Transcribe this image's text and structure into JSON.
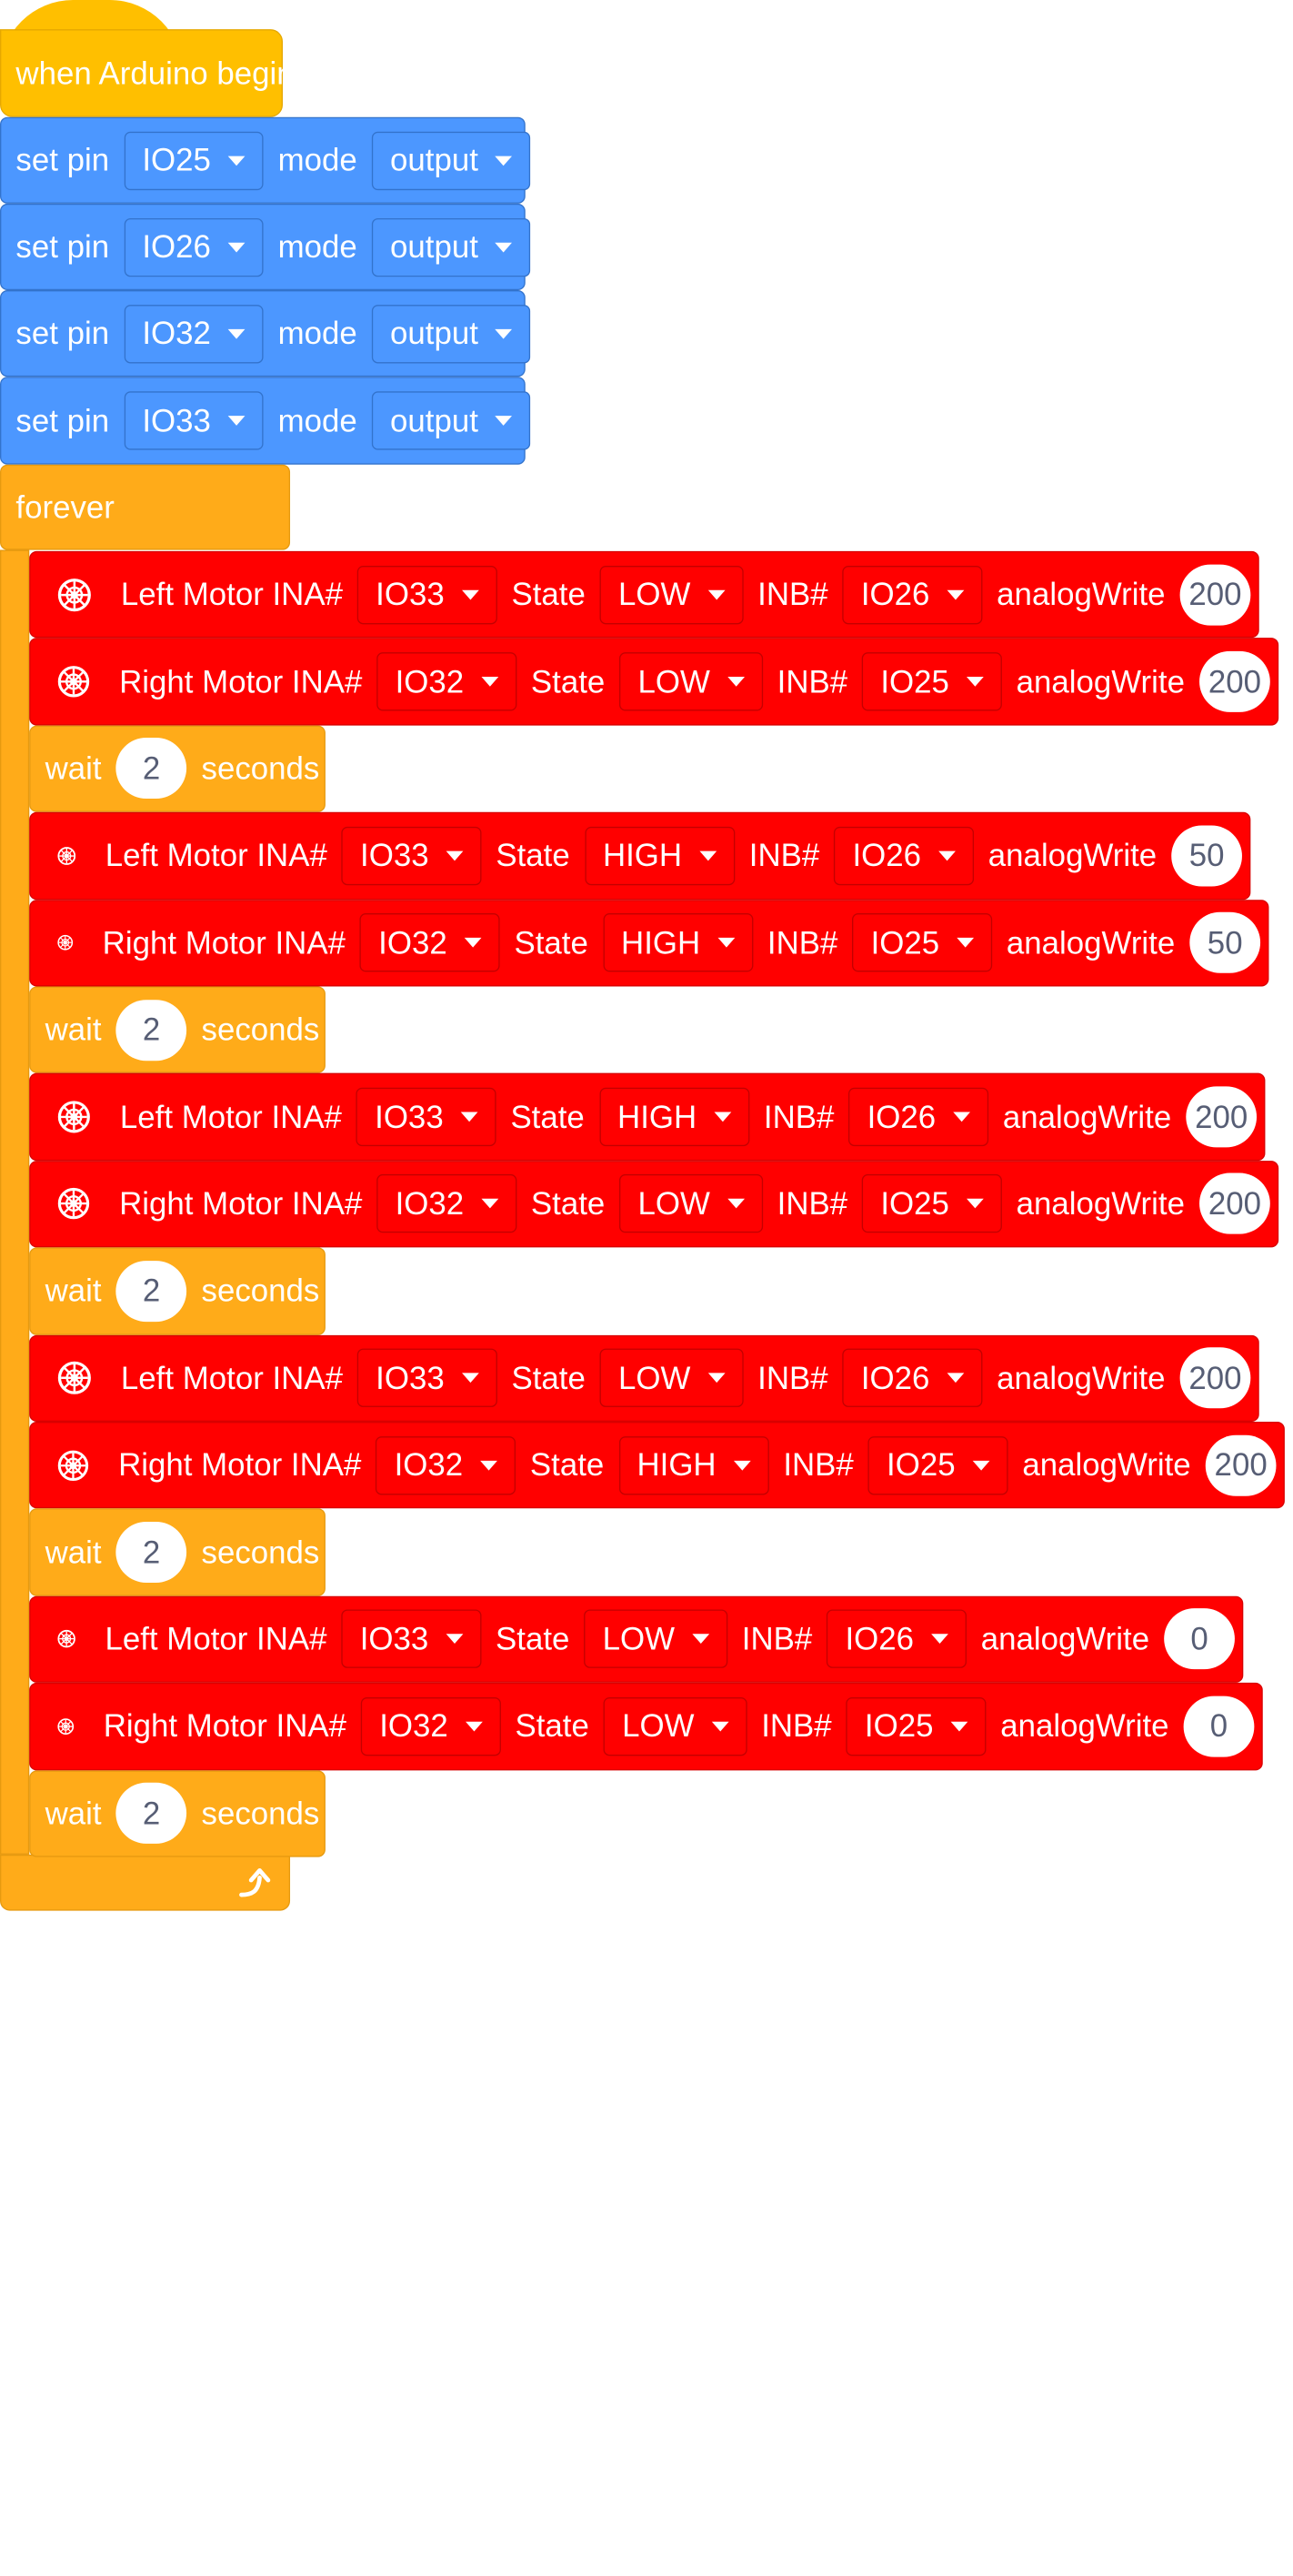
{
  "colors": {
    "event": "#FFBF00",
    "pins": "#4C97FF",
    "control": "#FFAB19",
    "motor": "#FF0000"
  },
  "hat": {
    "label": "when Arduino begin"
  },
  "setup": [
    {
      "set_label": "set pin",
      "pin": "IO25",
      "mode_label": "mode",
      "mode": "output"
    },
    {
      "set_label": "set pin",
      "pin": "IO26",
      "mode_label": "mode",
      "mode": "output"
    },
    {
      "set_label": "set pin",
      "pin": "IO32",
      "mode_label": "mode",
      "mode": "output"
    },
    {
      "set_label": "set pin",
      "pin": "IO33",
      "mode_label": "mode",
      "mode": "output"
    }
  ],
  "loop": {
    "label": "forever",
    "icon": "loop-arrow-icon"
  },
  "motor_labels": {
    "state": "State",
    "inb": "INB#",
    "analog": "analogWrite"
  },
  "wait_labels": {
    "wait": "wait",
    "seconds": "seconds"
  },
  "motors": [
    {
      "title": "Left Motor INA#",
      "ina": "IO33",
      "state": "LOW",
      "inb": "IO26",
      "value": "200",
      "icon": "wheel-icon"
    },
    {
      "title": "Right Motor INA#",
      "ina": "IO32",
      "state": "LOW",
      "inb": "IO25",
      "value": "200",
      "icon": "wheel-icon"
    },
    {
      "title": "Left Motor INA#",
      "ina": "IO33",
      "state": "HIGH",
      "inb": "IO26",
      "value": "50",
      "icon": "wheel-icon"
    },
    {
      "title": "Right Motor INA#",
      "ina": "IO32",
      "state": "HIGH",
      "inb": "IO25",
      "value": "50",
      "icon": "wheel-icon"
    },
    {
      "title": "Left Motor INA#",
      "ina": "IO33",
      "state": "HIGH",
      "inb": "IO26",
      "value": "200",
      "icon": "wheel-icon"
    },
    {
      "title": "Right Motor INA#",
      "ina": "IO32",
      "state": "LOW",
      "inb": "IO25",
      "value": "200",
      "icon": "wheel-icon"
    },
    {
      "title": "Left Motor INA#",
      "ina": "IO33",
      "state": "LOW",
      "inb": "IO26",
      "value": "200",
      "icon": "wheel-icon"
    },
    {
      "title": "Right Motor INA#",
      "ina": "IO32",
      "state": "HIGH",
      "inb": "IO25",
      "value": "200",
      "icon": "wheel-icon"
    },
    {
      "title": "Left Motor INA#",
      "ina": "IO33",
      "state": "LOW",
      "inb": "IO26",
      "value": "0",
      "icon": "wheel-icon"
    },
    {
      "title": "Right Motor INA#",
      "ina": "IO32",
      "state": "LOW",
      "inb": "IO25",
      "value": "0",
      "icon": "wheel-icon"
    }
  ],
  "waits": [
    {
      "value": "2"
    },
    {
      "value": "2"
    },
    {
      "value": "2"
    },
    {
      "value": "2"
    },
    {
      "value": "2"
    }
  ]
}
